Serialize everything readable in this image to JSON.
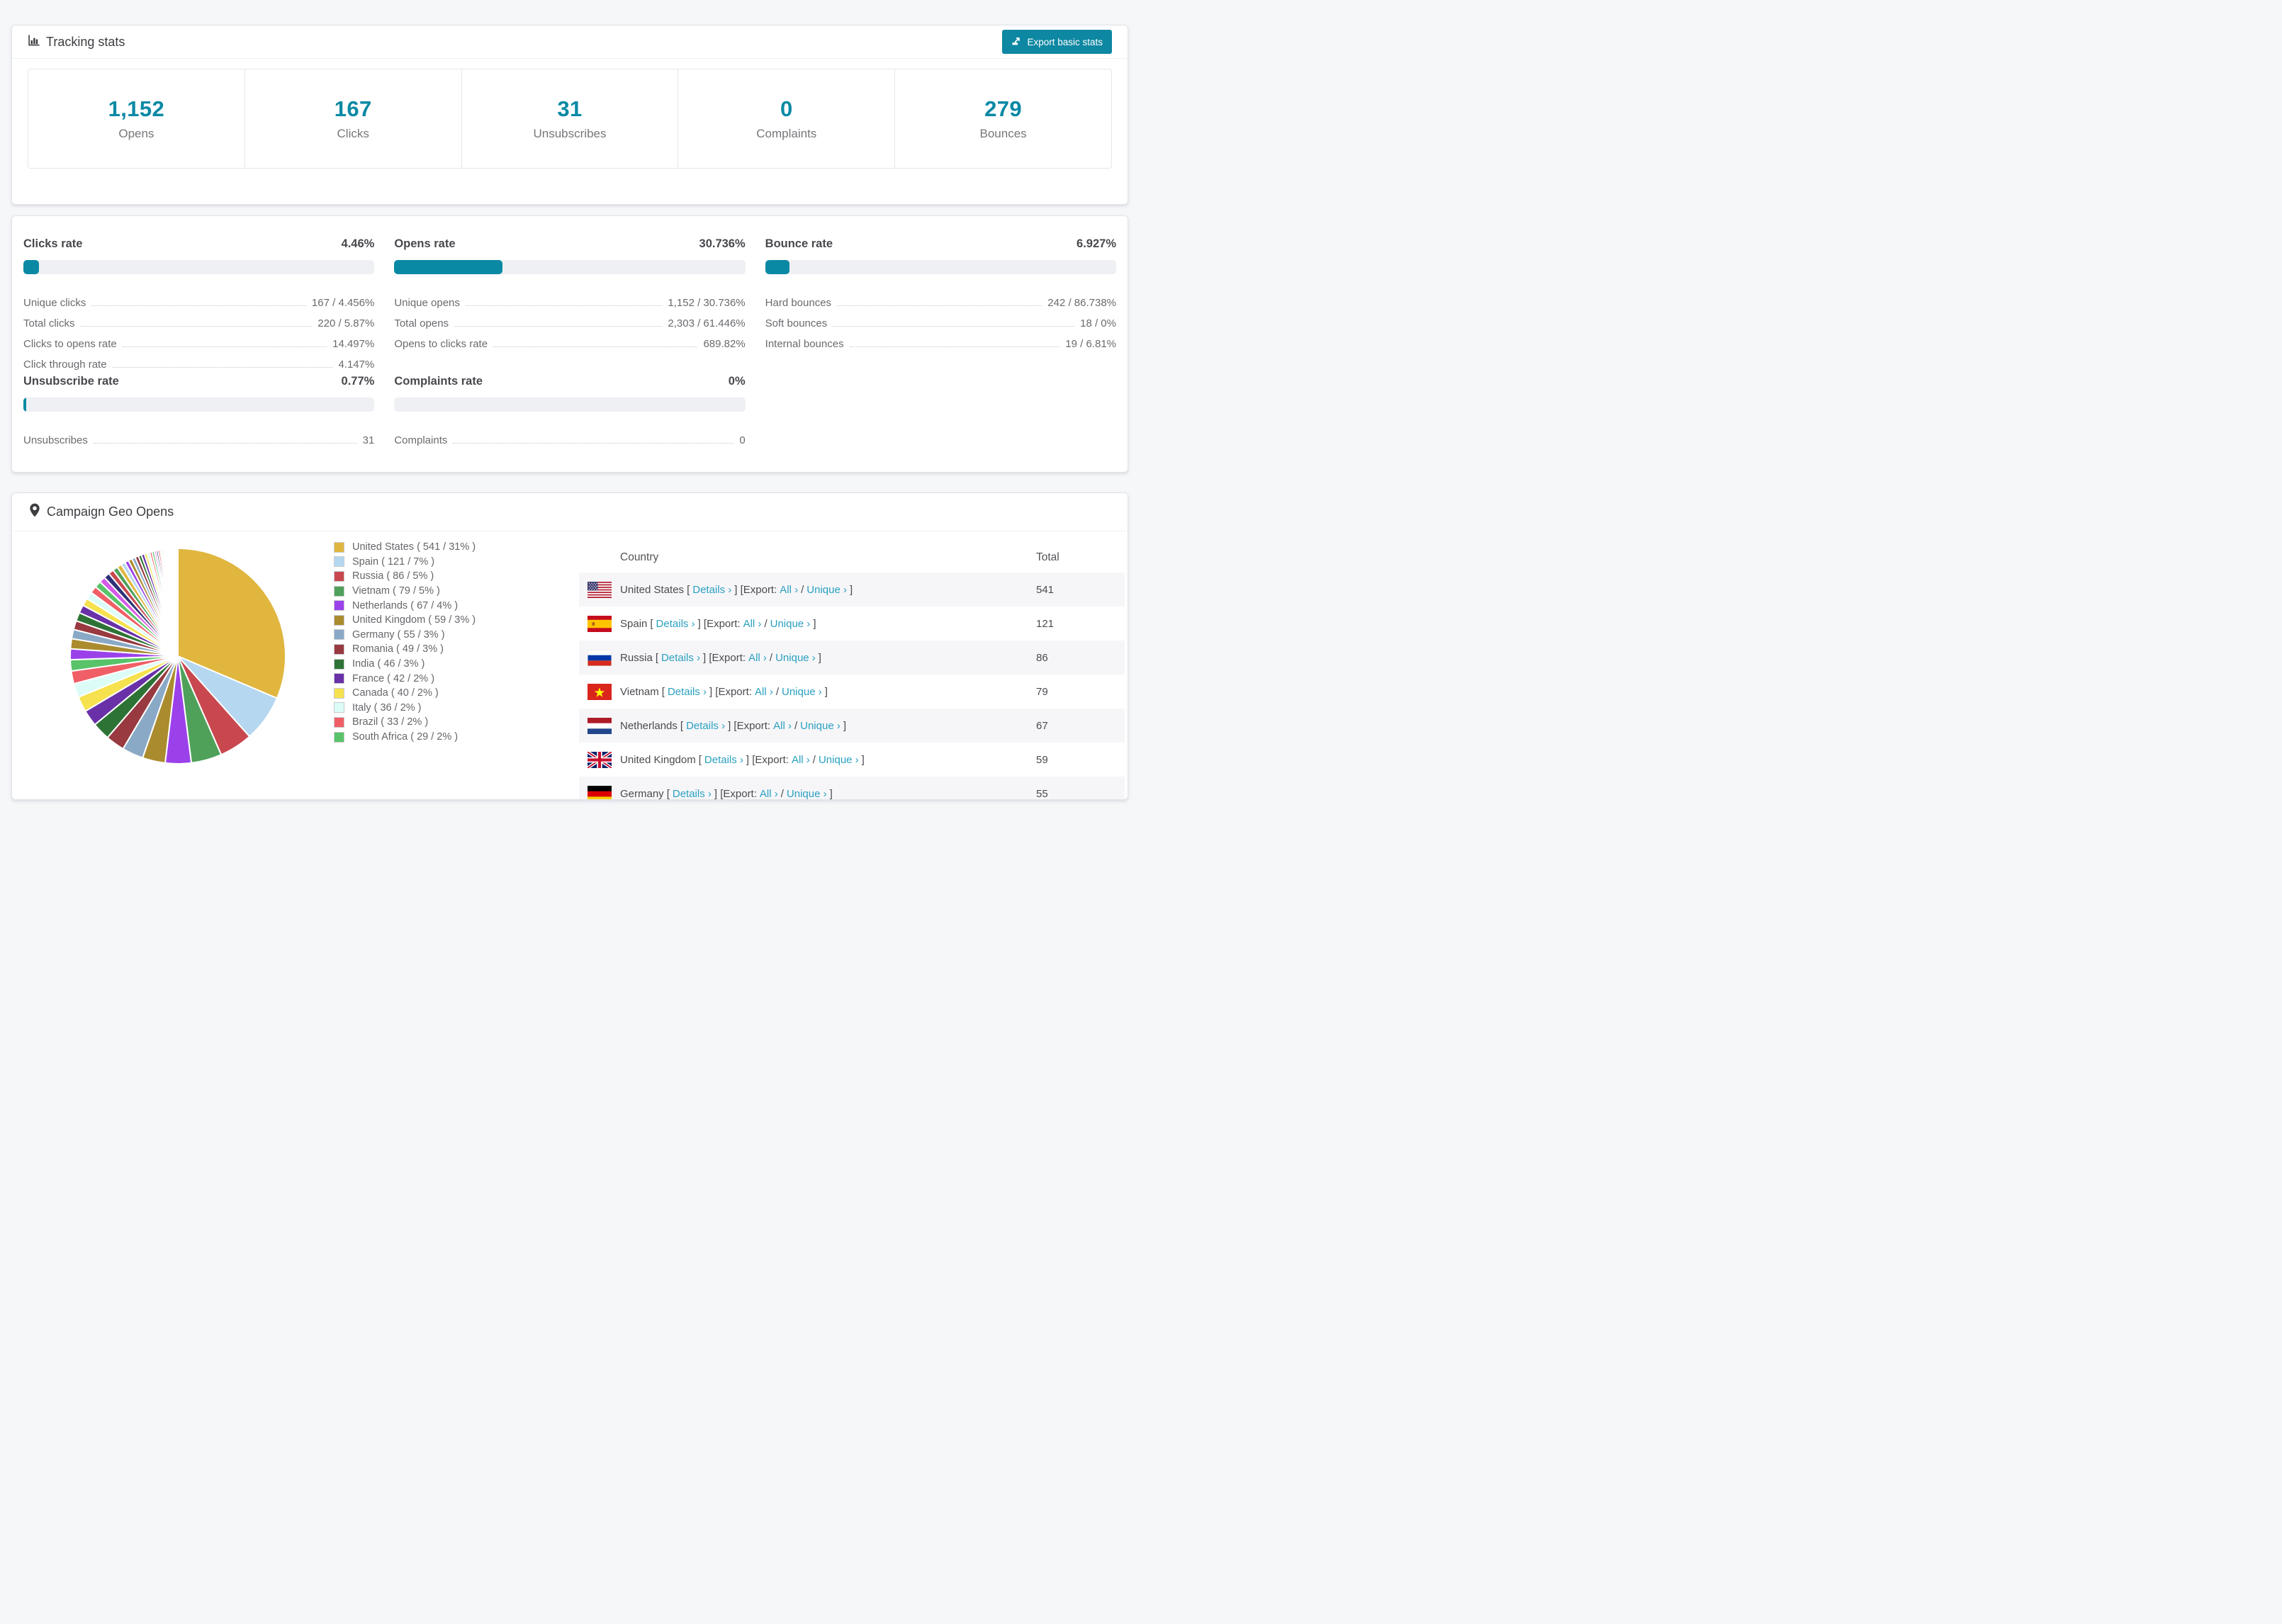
{
  "tracking": {
    "title": "Tracking stats",
    "export_button": "Export basic stats",
    "stats": [
      {
        "value": "1,152",
        "label": "Opens"
      },
      {
        "value": "167",
        "label": "Clicks"
      },
      {
        "value": "31",
        "label": "Unsubscribes"
      },
      {
        "value": "0",
        "label": "Complaints"
      },
      {
        "value": "279",
        "label": "Bounces"
      }
    ]
  },
  "rates": {
    "sections": [
      {
        "title": "Clicks rate",
        "value": "4.46%",
        "percent": 4.46,
        "items": [
          {
            "label": "Unique clicks",
            "value": "167 / 4.456%"
          },
          {
            "label": "Total clicks",
            "value": "220 / 5.87%"
          },
          {
            "label": "Clicks to opens rate",
            "value": "14.497%"
          },
          {
            "label": "Click through rate",
            "value": "4.147%"
          }
        ]
      },
      {
        "title": "Opens rate",
        "value": "30.736%",
        "percent": 30.736,
        "items": [
          {
            "label": "Unique opens",
            "value": "1,152 / 30.736%"
          },
          {
            "label": "Total opens",
            "value": "2,303 / 61.446%"
          },
          {
            "label": "Opens to clicks rate",
            "value": "689.82%"
          }
        ]
      },
      {
        "title": "Bounce rate",
        "value": "6.927%",
        "percent": 6.927,
        "items": [
          {
            "label": "Hard bounces",
            "value": "242 / 86.738%"
          },
          {
            "label": "Soft bounces",
            "value": "18 / 0%"
          },
          {
            "label": "Internal bounces",
            "value": "19 / 6.81%"
          }
        ]
      },
      {
        "title": "Unsubscribe rate",
        "value": "0.77%",
        "percent": 0.77,
        "items": [
          {
            "label": "Unsubscribes",
            "value": "31"
          }
        ]
      },
      {
        "title": "Complaints rate",
        "value": "0%",
        "percent": 0,
        "items": [
          {
            "label": "Complaints",
            "value": "0"
          }
        ]
      }
    ]
  },
  "geo": {
    "title": "Campaign Geo Opens",
    "chart_data": {
      "type": "pie",
      "title": "Campaign Geo Opens",
      "legend_position": "right of pie",
      "start_angle_deg": -90,
      "direction": "clockwise",
      "slices": [
        {
          "label": "United States",
          "value": 541,
          "pct": "31%",
          "color": "#e0b63e",
          "text": "United States ( 541 / 31% )"
        },
        {
          "label": "Spain",
          "value": 121,
          "pct": "7%",
          "color": "#b5d7f0",
          "text": "Spain ( 121 / 7% )"
        },
        {
          "label": "Russia",
          "value": 86,
          "pct": "5%",
          "color": "#c9484f",
          "text": "Russia ( 86 / 5% )"
        },
        {
          "label": "Vietnam",
          "value": 79,
          "pct": "5%",
          "color": "#4fa15a",
          "text": "Vietnam ( 79 / 5% )"
        },
        {
          "label": "Netherlands",
          "value": 67,
          "pct": "4%",
          "color": "#9b41ea",
          "text": "Netherlands ( 67 / 4% )"
        },
        {
          "label": "United Kingdom",
          "value": 59,
          "pct": "3%",
          "color": "#aa8b2e",
          "text": "United Kingdom ( 59 / 3% )"
        },
        {
          "label": "Germany",
          "value": 55,
          "pct": "3%",
          "color": "#8aa9c6",
          "text": "Germany ( 55 / 3% )"
        },
        {
          "label": "Romania",
          "value": 49,
          "pct": "3%",
          "color": "#983a40",
          "text": "Romania ( 49 / 3% )"
        },
        {
          "label": "India",
          "value": 46,
          "pct": "3%",
          "color": "#2d7335",
          "text": "India ( 46 / 3% )"
        },
        {
          "label": "France",
          "value": 42,
          "pct": "2%",
          "color": "#6930a8",
          "text": "France ( 42 / 2% )"
        },
        {
          "label": "Canada",
          "value": 40,
          "pct": "2%",
          "color": "#f6e14e",
          "text": "Canada ( 40 / 2% )"
        },
        {
          "label": "Italy",
          "value": 36,
          "pct": "2%",
          "color": "#dcfcf7",
          "text": "Italy ( 36 / 2% )"
        },
        {
          "label": "Brazil",
          "value": 33,
          "pct": "2%",
          "color": "#f05f66",
          "text": "Brazil ( 33 / 2% )"
        },
        {
          "label": "South Africa",
          "value": 29,
          "pct": "2%",
          "color": "#58c369",
          "text": "South Africa ( 29 / 2% )"
        }
      ],
      "other_values": [
        28,
        26,
        24,
        23,
        22,
        21,
        20,
        19,
        18,
        17,
        16,
        15,
        14,
        13,
        12,
        11,
        10,
        10,
        9,
        9,
        8,
        8,
        7,
        7,
        6,
        6,
        5,
        5,
        5,
        4,
        4,
        4,
        3,
        3,
        3,
        3,
        2,
        2,
        2,
        2,
        2,
        2,
        1,
        1,
        1,
        1,
        1,
        1,
        1,
        1,
        1,
        1
      ],
      "other_palette": [
        "#9b41ea",
        "#aa8b2e",
        "#8aa9c6",
        "#983a40",
        "#2d7335",
        "#6930a8",
        "#f6e14e",
        "#dcfcf7",
        "#f05f66",
        "#58c369",
        "#d65ae8",
        "#2e3178",
        "#c9484f",
        "#4fa15a",
        "#e0b63e",
        "#b5d7f0"
      ]
    },
    "table": {
      "columns": [
        "Country",
        "Total"
      ],
      "links": {
        "open": "[",
        "details": "Details ›",
        "close_export": "] [Export:",
        "all": "All ›",
        "slash": "/",
        "unique": "Unique ›",
        "close": "]"
      },
      "rows": [
        {
          "flag": "us",
          "country": "United States",
          "total": "541"
        },
        {
          "flag": "es",
          "country": "Spain",
          "total": "121"
        },
        {
          "flag": "ru",
          "country": "Russia",
          "total": "86"
        },
        {
          "flag": "vn",
          "country": "Vietnam",
          "total": "79"
        },
        {
          "flag": "nl",
          "country": "Netherlands",
          "total": "67"
        },
        {
          "flag": "gb",
          "country": "United Kingdom",
          "total": "59"
        },
        {
          "flag": "de",
          "country": "Germany",
          "total": "55"
        }
      ]
    }
  }
}
